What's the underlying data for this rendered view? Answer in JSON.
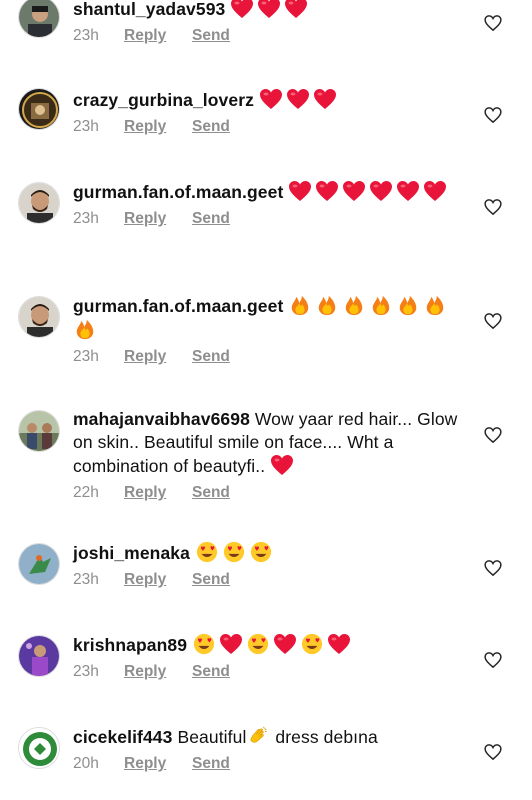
{
  "comments": [
    {
      "username": "shantul_yadav593",
      "text": "",
      "emojis": [
        "heart",
        "heart",
        "heart"
      ],
      "time": "23h",
      "reply": "Reply",
      "send": "Send",
      "avatar": "portrait-dark"
    },
    {
      "username": "crazy_gurbina_loverz",
      "text": "",
      "emojis": [
        "heart",
        "heart",
        "heart"
      ],
      "time": "23h",
      "reply": "Reply",
      "send": "Send",
      "avatar": "badge-circle"
    },
    {
      "username": "gurman.fan.of.maan.geet",
      "text": "",
      "emojis": [
        "heart",
        "heart",
        "heart",
        "heart",
        "heart",
        "heart"
      ],
      "time": "23h",
      "reply": "Reply",
      "send": "Send",
      "avatar": "portrait-beard"
    },
    {
      "username": "gurman.fan.of.maan.geet",
      "text": "",
      "emojis": [
        "fire",
        "fire",
        "fire",
        "fire",
        "fire",
        "fire",
        "fire"
      ],
      "time": "23h",
      "reply": "Reply",
      "send": "Send",
      "avatar": "portrait-beard"
    },
    {
      "username": "mahajanvaibhav6698",
      "text": " Wow yaar red hair... Glow on skin.. Beautiful smile on face.... Wht a combination of beautyfi.. ",
      "emojis": [
        "heart"
      ],
      "time": "22h",
      "reply": "Reply",
      "send": "Send",
      "avatar": "group-photo"
    },
    {
      "username": "joshi_menaka",
      "text": "",
      "emojis": [
        "heart-eyes",
        "heart-eyes",
        "heart-eyes"
      ],
      "time": "23h",
      "reply": "Reply",
      "send": "Send",
      "avatar": "sky-figure"
    },
    {
      "username": "krishnapan89",
      "text": "",
      "emojis": [
        "heart-eyes",
        "heart",
        "heart-eyes",
        "heart",
        "heart-eyes",
        "heart"
      ],
      "time": "23h",
      "reply": "Reply",
      "send": "Send",
      "avatar": "purple-figure"
    },
    {
      "username": "cicekelif443",
      "text": " Beautiful",
      "emojis_inline": [
        "clap"
      ],
      "text_after": " dress debına",
      "emojis": [],
      "time": "20h",
      "reply": "Reply",
      "send": "Send",
      "avatar": "green-logo"
    }
  ],
  "colors": {
    "heart": "#e8143a",
    "meta": "#8e8e8e",
    "like": "#262626"
  }
}
